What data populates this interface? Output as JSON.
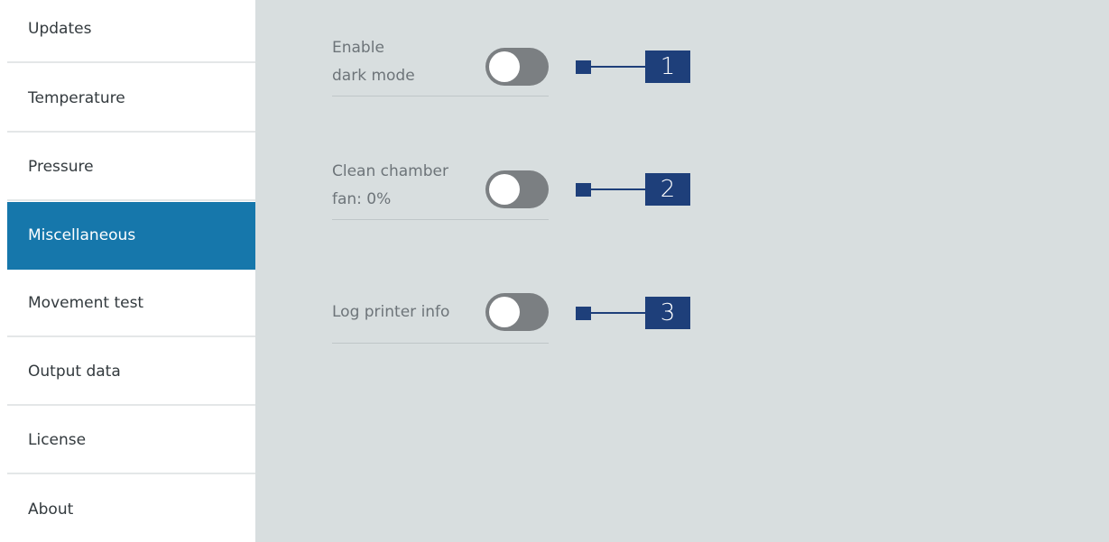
{
  "sidebar": {
    "items": [
      {
        "label": "Updates",
        "active": false
      },
      {
        "label": "Temperature",
        "active": false
      },
      {
        "label": "Pressure",
        "active": false
      },
      {
        "label": "Miscellaneous",
        "active": true
      },
      {
        "label": "Movement test",
        "active": false
      },
      {
        "label": "Output data",
        "active": false
      },
      {
        "label": "License",
        "active": false
      },
      {
        "label": "About",
        "active": false
      }
    ],
    "active_color": "#1677ab"
  },
  "settings": {
    "dark_mode": {
      "label_line1": "Enable",
      "label_line2": "dark mode",
      "enabled": false
    },
    "clean_chamber": {
      "label_line1": "Clean chamber",
      "label_line2": "fan: 0%",
      "enabled": false
    },
    "log_printer": {
      "label": "Log printer info",
      "enabled": false
    }
  },
  "callouts": [
    "1",
    "2",
    "3"
  ],
  "colors": {
    "panel_background": "#d8dedf",
    "toggle_off": "#7b7f82",
    "callout": "#1e3f7a"
  }
}
